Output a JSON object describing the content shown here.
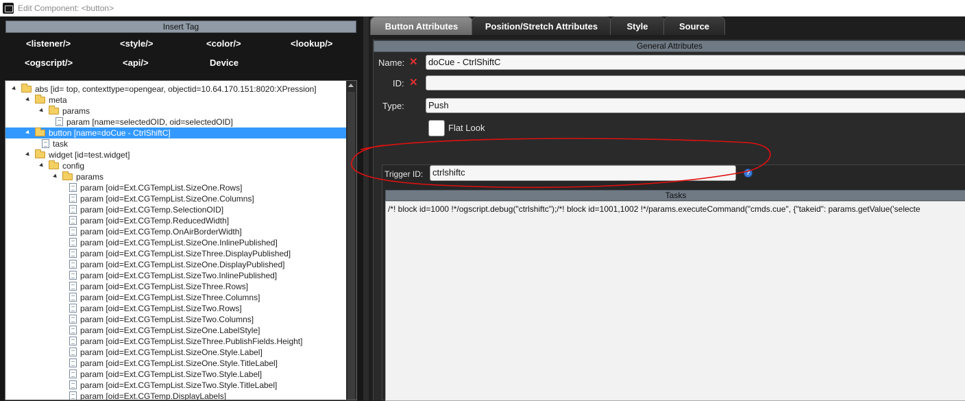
{
  "window": {
    "title": "Edit Component: <button>"
  },
  "left": {
    "insert_tag_label": "Insert Tag",
    "tags": [
      "<listener/>",
      "<style/>",
      "<color/>",
      "<lookup/>",
      "<ogscript/>",
      "<api/>",
      "Device"
    ],
    "tree": [
      {
        "text": "abs [id=  top, contexttype=opengear, objectid=10.64.170.151:8020:XPression]",
        "kind": "folder",
        "expanded": true,
        "level": 0
      },
      {
        "text": "meta",
        "kind": "folder",
        "expanded": true,
        "level": 1
      },
      {
        "text": "params",
        "kind": "folder",
        "expanded": true,
        "level": 2
      },
      {
        "text": "param [name=selectedOID, oid=selectedOID]",
        "kind": "doc",
        "level": 3
      },
      {
        "text": "button [name=doCue - CtrlShiftC]",
        "kind": "folder",
        "expanded": true,
        "level": 1,
        "selected": true
      },
      {
        "text": "task",
        "kind": "doc",
        "level": 2
      },
      {
        "text": "widget [id=test.widget]",
        "kind": "folder",
        "expanded": true,
        "level": 1
      },
      {
        "text": "config",
        "kind": "folder",
        "expanded": true,
        "level": 2
      },
      {
        "text": "params",
        "kind": "folder",
        "expanded": true,
        "level": 3
      },
      {
        "text": "param [oid=Ext.CGTempList.SizeOne.Rows]",
        "kind": "doc",
        "level": 4
      },
      {
        "text": "param [oid=Ext.CGTempList.SizeOne.Columns]",
        "kind": "doc",
        "level": 4
      },
      {
        "text": "param [oid=Ext.CGTemp.SelectionOID]",
        "kind": "doc",
        "level": 4
      },
      {
        "text": "param [oid=Ext.CGTemp.ReducedWidth]",
        "kind": "doc",
        "level": 4
      },
      {
        "text": "param [oid=Ext.CGTemp.OnAirBorderWidth]",
        "kind": "doc",
        "level": 4
      },
      {
        "text": "param [oid=Ext.CGTempList.SizeOne.InlinePublished]",
        "kind": "doc",
        "level": 4
      },
      {
        "text": "param [oid=Ext.CGTempList.SizeThree.DisplayPublished]",
        "kind": "doc",
        "level": 4
      },
      {
        "text": "param [oid=Ext.CGTempList.SizeOne.DisplayPublished]",
        "kind": "doc",
        "level": 4
      },
      {
        "text": "param [oid=Ext.CGTempList.SizeTwo.InlinePublished]",
        "kind": "doc",
        "level": 4
      },
      {
        "text": "param [oid=Ext.CGTempList.SizeThree.Rows]",
        "kind": "doc",
        "level": 4
      },
      {
        "text": "param [oid=Ext.CGTempList.SizeThree.Columns]",
        "kind": "doc",
        "level": 4
      },
      {
        "text": "param [oid=Ext.CGTempList.SizeTwo.Rows]",
        "kind": "doc",
        "level": 4
      },
      {
        "text": "param [oid=Ext.CGTempList.SizeTwo.Columns]",
        "kind": "doc",
        "level": 4
      },
      {
        "text": "param [oid=Ext.CGTempList.SizeOne.LabelStyle]",
        "kind": "doc",
        "level": 4
      },
      {
        "text": "param [oid=Ext.CGTempList.SizeThree.PublishFields.Height]",
        "kind": "doc",
        "level": 4
      },
      {
        "text": "param [oid=Ext.CGTempList.SizeOne.Style.Label]",
        "kind": "doc",
        "level": 4
      },
      {
        "text": "param [oid=Ext.CGTempList.SizeOne.Style.TitleLabel]",
        "kind": "doc",
        "level": 4
      },
      {
        "text": "param [oid=Ext.CGTempList.SizeTwo.Style.Label]",
        "kind": "doc",
        "level": 4
      },
      {
        "text": "param [oid=Ext.CGTempList.SizeTwo.Style.TitleLabel]",
        "kind": "doc",
        "level": 4
      },
      {
        "text": "param [oid=Ext.CGTemp.DisplayLabels]",
        "kind": "doc",
        "level": 4
      }
    ]
  },
  "right": {
    "tabs": [
      "Button Attributes",
      "Position/Stretch Attributes",
      "Style",
      "Source"
    ],
    "active_tab": 0,
    "general_header": "General Attributes",
    "name_label": "Name:",
    "name_value": "doCue - CtrlShiftC",
    "id_label": "ID:",
    "id_value": "",
    "type_label": "Type:",
    "type_value": "Push",
    "flat_look_label": "Flat Look",
    "trigger_label": "Trigger ID:",
    "trigger_value": "ctrlshiftc",
    "tasks_header": "Tasks",
    "tasks_text": "/*! block id=1000 !*/ogscript.debug(\"ctrlshiftc\");/*! block id=1001,1002 !*/params.executeCommand(\"cmds.cue\", {\"takeid\": params.getValue('selecte"
  },
  "colors": {
    "selected_row": "#3399ff",
    "annotation": "#e01010",
    "remove_icon": "#e23030"
  },
  "icons": {
    "remove": "✕",
    "help": "?"
  }
}
